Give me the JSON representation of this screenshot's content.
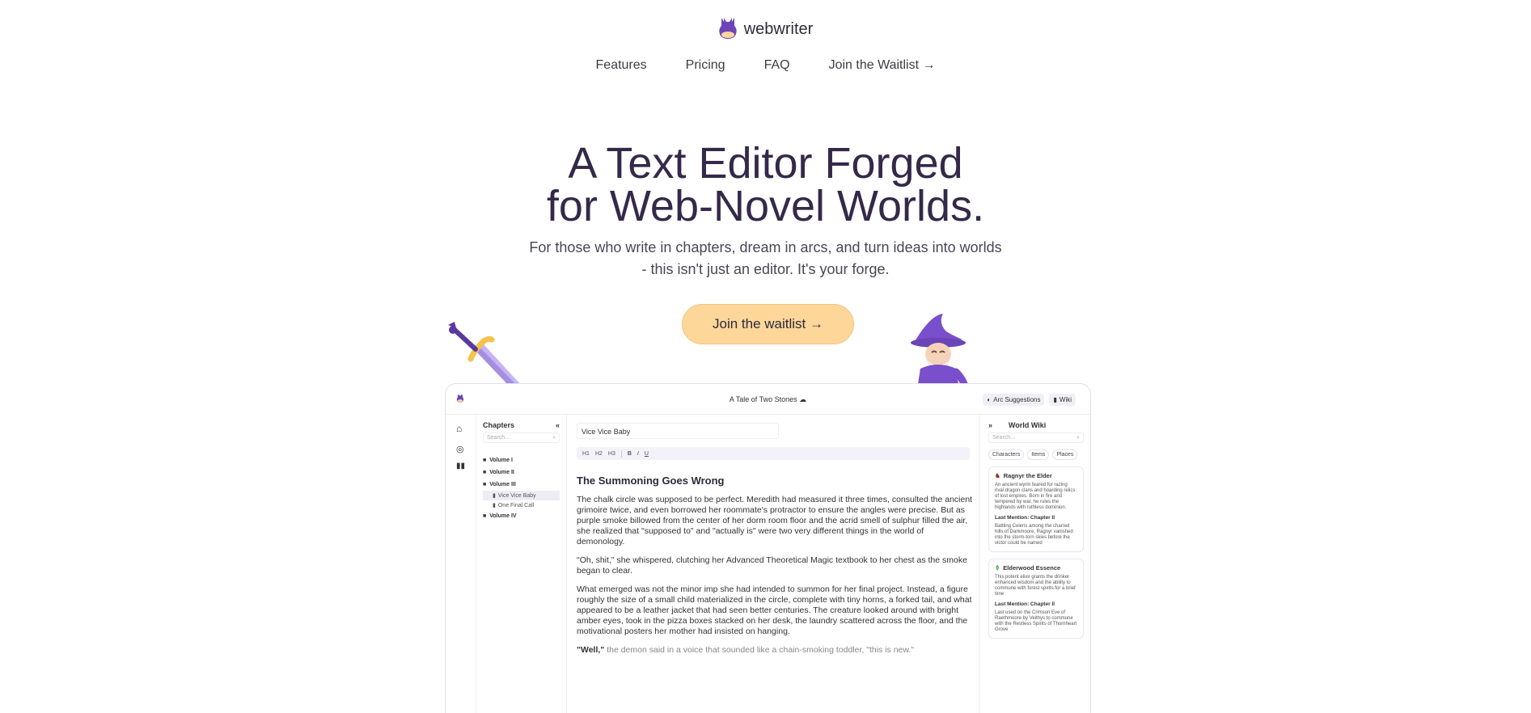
{
  "brand": {
    "name": "webwriter",
    "logo_icon": "flask-icon"
  },
  "nav": {
    "features": "Features",
    "pricing": "Pricing",
    "faq": "FAQ",
    "waitlist": "Join the Waitlist →"
  },
  "hero": {
    "title_line1": "A Text Editor Forged",
    "title_line2": "for Web-Novel Worlds.",
    "sub_line1": "For those who write in chapters, dream in arcs, and turn ideas into worlds",
    "sub_line2": "- this isn't just an editor. It's your forge.",
    "cta": "Join the waitlist →"
  },
  "colors": {
    "accent": "#6c44b8",
    "cta_bg": "#fdd69a",
    "title": "#35294a"
  },
  "app": {
    "doc_title": "A Tale of Two Stones",
    "arc_button": "Arc Suggestions",
    "wiki_button": "Wiki",
    "sidebar": {
      "title": "Chapters",
      "search_placeholder": "Search...",
      "volumes": [
        {
          "label": "Volume I"
        },
        {
          "label": "Volume II"
        },
        {
          "label": "Volume III"
        },
        {
          "label": "Volume IV"
        }
      ],
      "chapters": [
        "Vice Vice Baby",
        "One Final Call"
      ]
    },
    "editor": {
      "chapter_title": "Vice Vice Baby",
      "toolbar": [
        "H1",
        "H2",
        "H3",
        "B",
        "I",
        "U"
      ],
      "heading": "The Summoning Goes Wrong",
      "paragraphs": [
        "The chalk circle was supposed to be perfect. Meredith had measured it three times, consulted the ancient grimoire twice, and even borrowed her roommate's protractor to ensure the angles were precise. But as purple smoke billowed from the center of her dorm room floor and the acrid smell of sulphur filled the air, she realized that \"supposed to\" and \"actually is\" were two very different things in the world of demonology.",
        "\"Oh, shit,\" she whispered, clutching her Advanced Theoretical Magic textbook to her chest as the smoke began to clear.",
        "What emerged was not the minor imp she had intended to summon for her final project. Instead, a figure roughly the size of a small child materialized in the circle, complete with tiny horns, a forked tail, and what appeared to be a leather jacket that had seen better centuries. The creature looked around with bright amber eyes, took in the pizza boxes stacked on her desk, the laundry scattered across the floor, and the motivational posters her mother had insisted on hanging."
      ],
      "last_bold": "\"Well,\"",
      "last_rest": " the demon said in a voice that sounded like a chain-smoking toddler, \"this is new.\""
    },
    "wiki": {
      "title": "World Wiki",
      "search_placeholder": "Search...",
      "tabs": [
        "Characters",
        "Items",
        "Places"
      ],
      "cards": [
        {
          "name": "Ragnyr the Elder",
          "icon": "dragon-icon",
          "desc": "An ancient wyrm feared for razing rival dragon clans and hoarding relics of lost empires. Born in fire and tempered by war, he rules the highlands with ruthless dominion.",
          "label": "Last Mention: Chapter II",
          "mention": "Battling Celeris among the charred hills of Darkmoore, Ragnyr vanished into the storm-torn skies before the victor could be named"
        },
        {
          "name": "Elderwood Essence",
          "icon": "potion-icon",
          "desc": "This potent elixir grants the drinker enhanced wisdom and the ability to commune with forest spirits for a brief time",
          "label": "Last Mention: Chapter II",
          "mention": "Last used on the Crimson Eve of Raethmoore by Veithys to commune with the Restless Spirits of Thornheart Grove"
        }
      ]
    }
  }
}
